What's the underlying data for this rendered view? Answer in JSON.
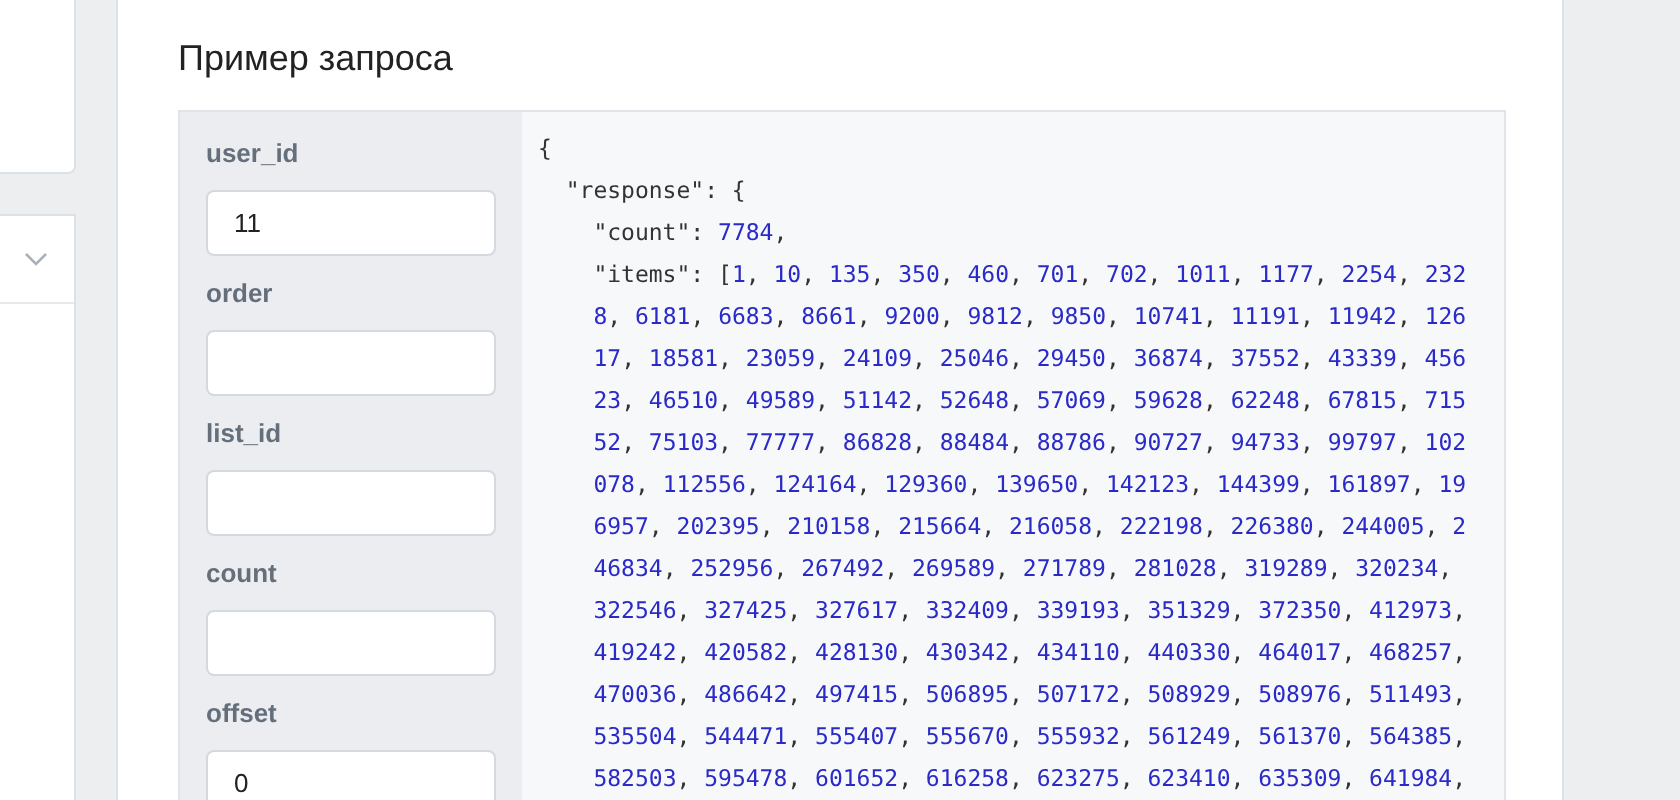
{
  "title": "Пример запроса",
  "params": [
    {
      "label": "user_id",
      "value": "11"
    },
    {
      "label": "order"
    },
    {
      "label": "list_id"
    },
    {
      "label": "count"
    },
    {
      "label": "offset",
      "value": "0"
    }
  ],
  "code_lines": [
    "{",
    "  \"response\": {",
    "    \"count\": 7784,",
    "    \"items\": [1, 10, 135, 350, 460, 701, 702, 1011, 1177, 2254, 232",
    "    8, 6181, 6683, 8661, 9200, 9812, 9850, 10741, 11191, 11942, 126",
    "    17, 18581, 23059, 24109, 25046, 29450, 36874, 37552, 43339, 456",
    "    23, 46510, 49589, 51142, 52648, 57069, 59628, 62248, 67815, 715",
    "    52, 75103, 77777, 86828, 88484, 88786, 90727, 94733, 99797, 102",
    "    078, 112556, 124164, 129360, 139650, 142123, 144399, 161897, 19",
    "    6957, 202395, 210158, 215664, 216058, 222198, 226380, 244005, 2",
    "    46834, 252956, 267492, 269589, 271789, 281028, 319289, 320234,",
    "    322546, 327425, 327617, 332409, 339193, 351329, 372350, 412973,",
    "    419242, 420582, 428130, 430342, 434110, 440330, 464017, 468257,",
    "    470036, 486642, 497415, 506895, 507172, 508929, 508976, 511493,",
    "    535504, 544471, 555407, 555670, 555932, 561249, 561370, 564385,",
    "    582503, 595478, 601652, 616258, 623275, 623410, 635309, 641984,"
  ]
}
